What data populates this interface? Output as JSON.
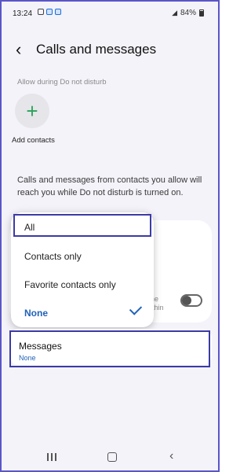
{
  "status_bar": {
    "time": "13:24",
    "battery": "84%"
  },
  "header": {
    "title": "Calls and messages"
  },
  "dnd": {
    "section_label": "Allow during Do not disturb",
    "add_contacts_label": "Add contacts",
    "info_text": "Calls and messages from contacts you allow will reach you while Do not disturb is turned on."
  },
  "dropdown": {
    "options": [
      "All",
      "Contacts only",
      "Favorite contacts only",
      "None"
    ],
    "selected": "None"
  },
  "background_row": {
    "hint": "he\nithin",
    "toggle_on": false
  },
  "messages": {
    "title": "Messages",
    "value": "None"
  },
  "colors": {
    "accent": "#1f62b8",
    "highlight_border": "#3c3aa6",
    "add_icon": "#2aa35a"
  }
}
